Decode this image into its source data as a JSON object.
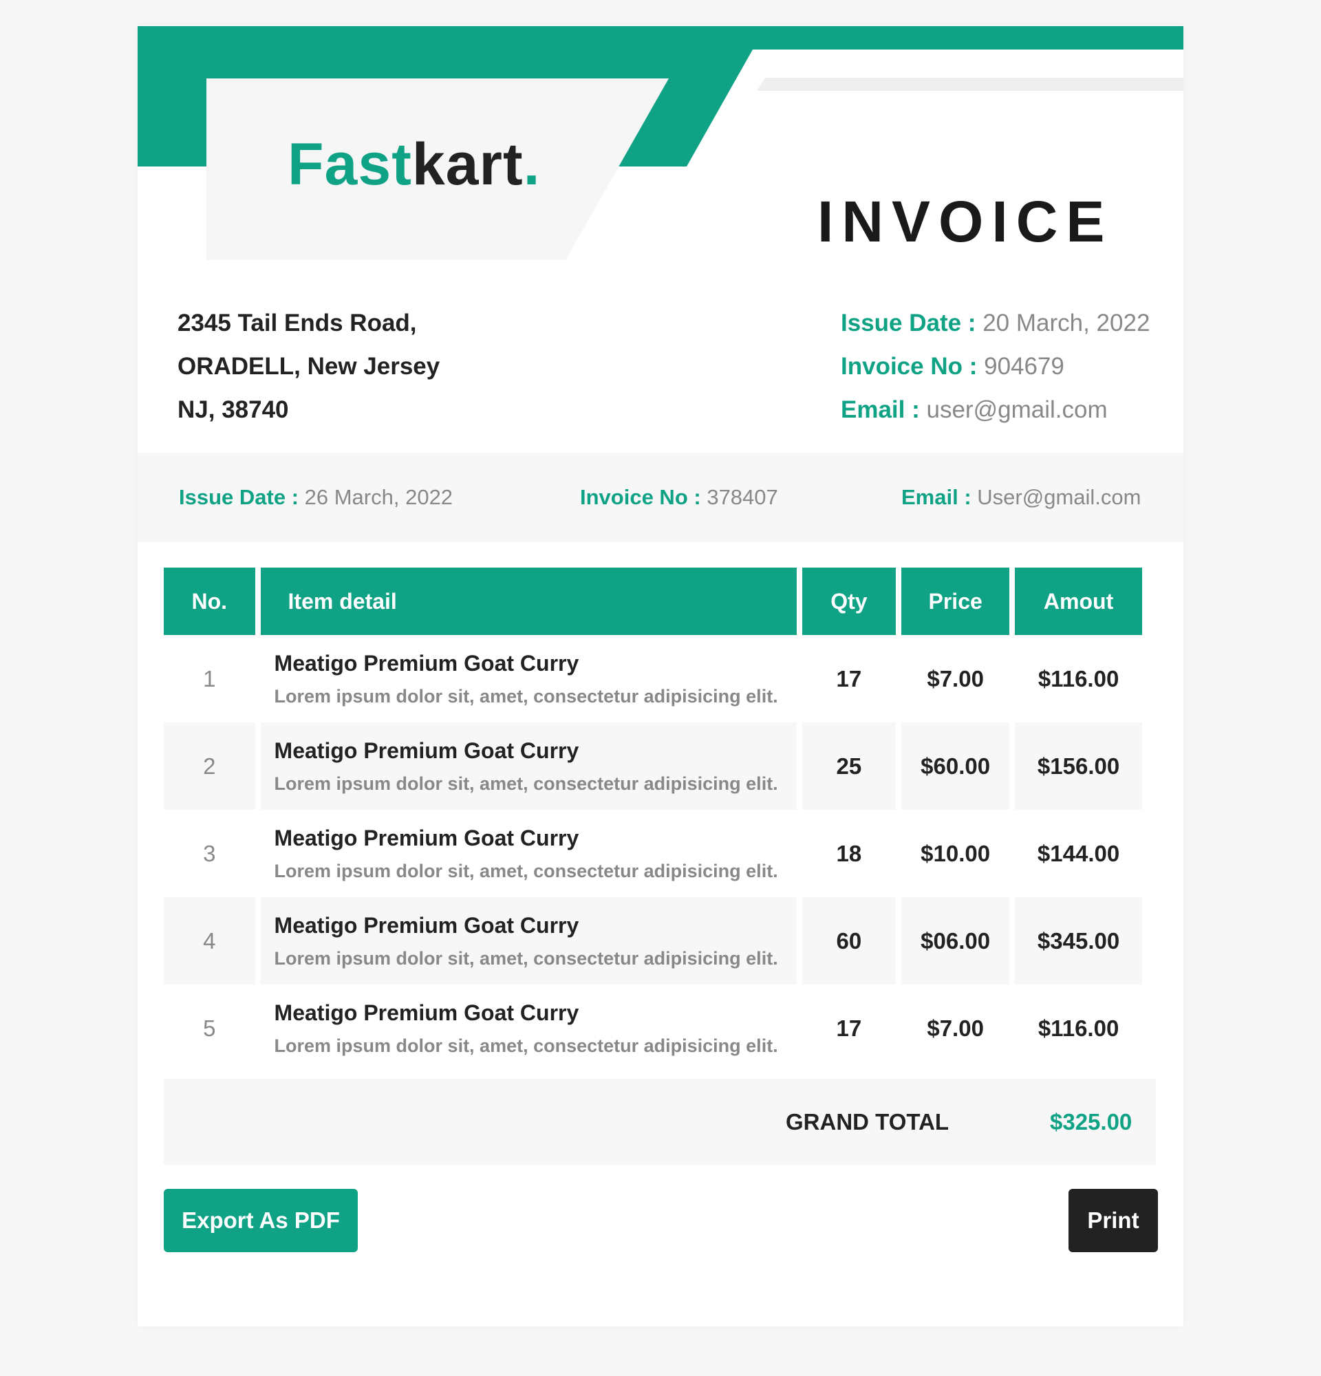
{
  "brand": {
    "fast": "Fast",
    "kart": "kart",
    "dot": ".",
    "accent": "#10a285"
  },
  "title": "INVOICE",
  "address": [
    "2345 Tail Ends Road,",
    "ORADELL, New Jersey",
    "NJ, 38740"
  ],
  "meta": [
    {
      "label": "Issue Date :",
      "value": "20 March, 2022"
    },
    {
      "label": "Invoice No :",
      "value": "904679"
    },
    {
      "label": "Email :",
      "value": "user@gmail.com"
    }
  ],
  "band": [
    {
      "label": "Issue Date :",
      "value": "26 March, 2022"
    },
    {
      "label": "Invoice No :",
      "value": "378407"
    },
    {
      "label": "Email :",
      "value": "User@gmail.com"
    }
  ],
  "table": {
    "headers": [
      "No.",
      "Item detail",
      "Qty",
      "Price",
      "Amout"
    ],
    "rows": [
      {
        "no": "1",
        "name": "Meatigo Premium Goat Curry",
        "desc": "Lorem ipsum dolor sit, amet, consectetur adipisicing elit.",
        "qty": "17",
        "price": "$7.00",
        "amount": "$116.00"
      },
      {
        "no": "2",
        "name": "Meatigo Premium Goat Curry",
        "desc": "Lorem ipsum dolor sit, amet, consectetur adipisicing elit.",
        "qty": "25",
        "price": "$60.00",
        "amount": "$156.00"
      },
      {
        "no": "3",
        "name": "Meatigo Premium Goat Curry",
        "desc": "Lorem ipsum dolor sit, amet, consectetur adipisicing elit.",
        "qty": "18",
        "price": "$10.00",
        "amount": "$144.00"
      },
      {
        "no": "4",
        "name": "Meatigo Premium Goat Curry",
        "desc": "Lorem ipsum dolor sit, amet, consectetur adipisicing elit.",
        "qty": "60",
        "price": "$06.00",
        "amount": "$345.00"
      },
      {
        "no": "5",
        "name": "Meatigo Premium Goat Curry",
        "desc": "Lorem ipsum dolor sit, amet, consectetur adipisicing elit.",
        "qty": "17",
        "price": "$7.00",
        "amount": "$116.00"
      }
    ]
  },
  "grand_total": {
    "label": "GRAND TOTAL",
    "value": "$325.00"
  },
  "buttons": {
    "export": "Export As PDF",
    "print": "Print"
  }
}
